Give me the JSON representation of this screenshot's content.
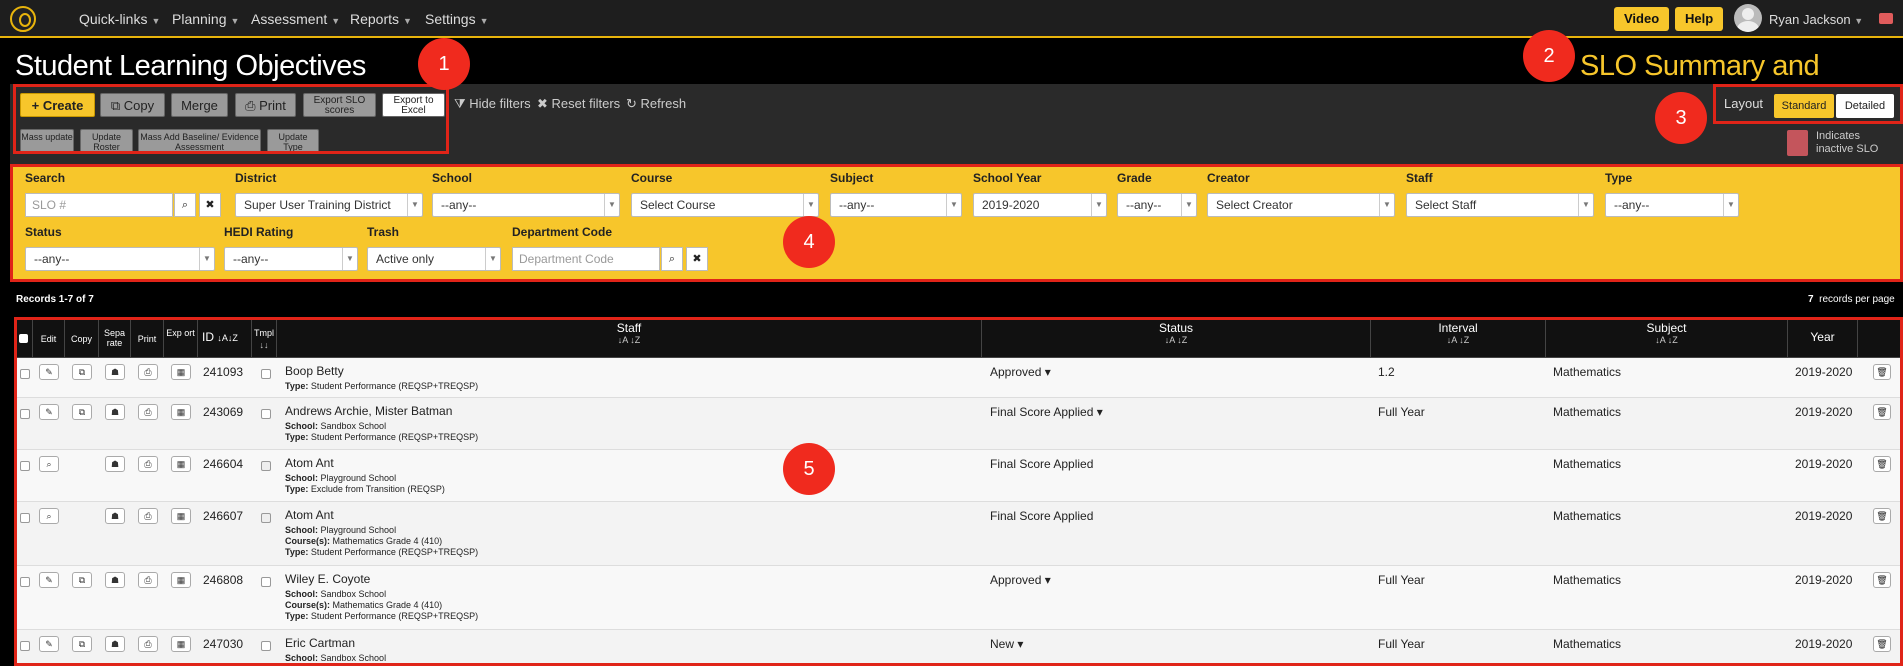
{
  "nav": {
    "menus": [
      "Quick-links",
      "Planning",
      "Assessment",
      "Reports",
      "Settings"
    ],
    "video": "Video",
    "help": "Help",
    "user": "Ryan Jackson"
  },
  "page": {
    "title": "Student Learning Objectives",
    "subtitle": "SLO Summary and Signoff"
  },
  "toolbar": {
    "create": "+ Create",
    "copy": "Copy",
    "merge": "Merge",
    "print": "Print",
    "export_scores": "Export SLO scores",
    "export_excel": "Export to Excel",
    "mass_update": "Mass update",
    "update_roster": "Update Roster",
    "mass_add": "Mass Add Baseline/ Evidence Assessment",
    "update_type": "Update Type",
    "hide_filters": "Hide filters",
    "reset_filters": "Reset filters",
    "refresh": "Refresh",
    "layout": "Layout",
    "standard": "Standard",
    "detailed": "Detailed",
    "inactive_note": "Indicates inactive SLO"
  },
  "filters": {
    "search": {
      "label": "Search",
      "placeholder": "SLO #"
    },
    "district": {
      "label": "District",
      "value": "Super User Training District"
    },
    "school": {
      "label": "School",
      "value": "--any--"
    },
    "course": {
      "label": "Course",
      "value": "Select Course"
    },
    "subject": {
      "label": "Subject",
      "value": "--any--"
    },
    "school_year": {
      "label": "School Year",
      "value": "2019-2020"
    },
    "grade": {
      "label": "Grade",
      "value": "--any--"
    },
    "creator": {
      "label": "Creator",
      "value": "Select Creator"
    },
    "staff": {
      "label": "Staff",
      "value": "Select Staff"
    },
    "type": {
      "label": "Type",
      "value": "--any--"
    },
    "status": {
      "label": "Status",
      "value": "--any--"
    },
    "hedi": {
      "label": "HEDI Rating",
      "value": "--any--"
    },
    "trash": {
      "label": "Trash",
      "value": "Active only"
    },
    "dept": {
      "label": "Department Code",
      "placeholder": "Department Code"
    }
  },
  "records": {
    "summary": "Records 1-7 of 7",
    "per_page_count": "7",
    "per_page_text": "records per page"
  },
  "table": {
    "headers": {
      "edit": "Edit",
      "copy": "Copy",
      "separate": "Sepa rate",
      "print": "Print",
      "export": "Exp ort",
      "id": "ID",
      "tmpl": "Tmpl",
      "staff": "Staff",
      "status": "Status",
      "interval": "Interval",
      "subject": "Subject",
      "year": "Year"
    },
    "rows": [
      {
        "id": "241093",
        "staff": "Boop Betty",
        "school": "",
        "courses": "",
        "type": "Student Performance (REQSP+TREQSP)",
        "status": "Approved ▾",
        "interval": "1.2",
        "subject": "Mathematics",
        "year": "2019-2020"
      },
      {
        "id": "243069",
        "staff": "Andrews Archie, Mister Batman",
        "school": "Sandbox School",
        "courses": "",
        "type": "Student Performance (REQSP+TREQSP)",
        "status": "Final Score Applied ▾",
        "interval": "Full Year",
        "subject": "Mathematics",
        "year": "2019-2020"
      },
      {
        "id": "246604",
        "staff": "Atom Ant",
        "school": "Playground School",
        "courses": "",
        "type": "Exclude from Transition (REQSP)",
        "status": "Final Score Applied",
        "interval": "",
        "subject": "Mathematics",
        "year": "2019-2020"
      },
      {
        "id": "246607",
        "staff": "Atom Ant",
        "school": "Playground School",
        "courses": "Mathematics Grade 4 (410)",
        "type": "Student Performance (REQSP+TREQSP)",
        "status": "Final Score Applied",
        "interval": "",
        "subject": "Mathematics",
        "year": "2019-2020"
      },
      {
        "id": "246808",
        "staff": "Wiley E. Coyote",
        "school": "Sandbox School",
        "courses": "Mathematics Grade 4 (410)",
        "type": "Student Performance (REQSP+TREQSP)",
        "status": "Approved ▾",
        "interval": "Full Year",
        "subject": "Mathematics",
        "year": "2019-2020"
      },
      {
        "id": "247030",
        "staff": "Eric Cartman",
        "school": "Sandbox School",
        "courses": "",
        "type": "",
        "status": "New ▾",
        "interval": "Full Year",
        "subject": "Mathematics",
        "year": "2019-2020"
      }
    ]
  },
  "labels": {
    "school": "School:",
    "courses": "Course(s):",
    "type": "Type:"
  },
  "callouts": [
    "1",
    "2",
    "3",
    "4",
    "5"
  ]
}
